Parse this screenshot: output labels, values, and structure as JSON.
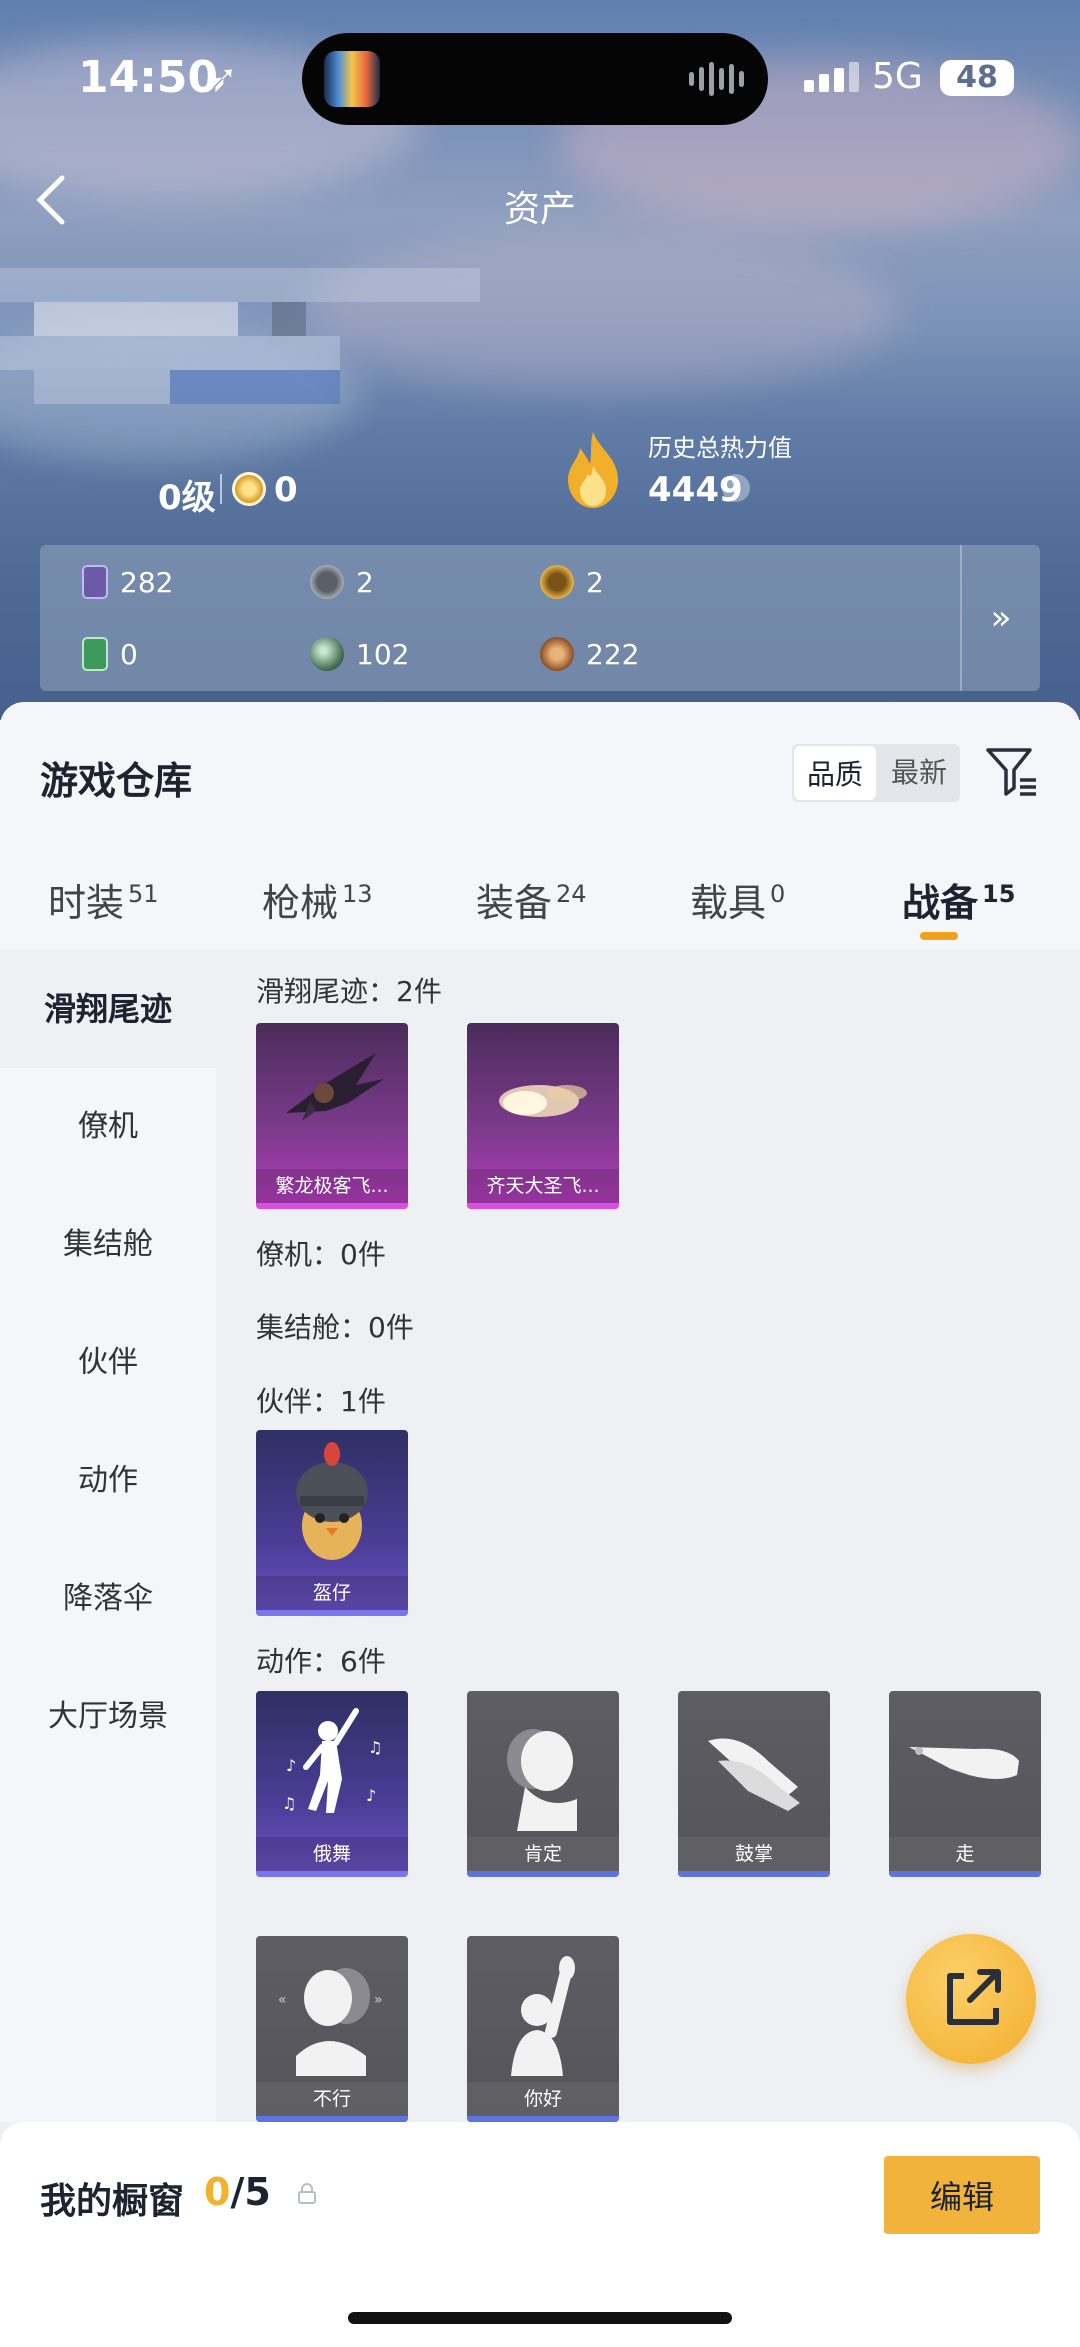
{
  "status_bar": {
    "time": "14:50",
    "network": "5G",
    "battery": "48"
  },
  "header": {
    "title": "资产"
  },
  "profile": {
    "level": "0级",
    "badge_value": "0",
    "heat_label": "历史总热力值",
    "heat_value": "4449",
    "help": "?"
  },
  "currencies": [
    {
      "icon": "purple-card-icon",
      "value": "282",
      "color": "#6b5aa8"
    },
    {
      "icon": "silver-coin-icon",
      "value": "2",
      "color": "#8a8f98"
    },
    {
      "icon": "gold-coin-icon",
      "value": "2",
      "color": "#d9a23a"
    },
    {
      "icon": "green-card-icon",
      "value": "0",
      "color": "#3e9a5c"
    },
    {
      "icon": "green-orb-icon",
      "value": "102",
      "color": "#5c8a6a"
    },
    {
      "icon": "bronze-coin-icon",
      "value": "222",
      "color": "#b8713a"
    }
  ],
  "currencies_more": "»",
  "warehouse": {
    "title": "游戏仓库",
    "sort_options": [
      "品质",
      "最新"
    ],
    "tabs": [
      {
        "label": "时装",
        "count": "51"
      },
      {
        "label": "枪械",
        "count": "13"
      },
      {
        "label": "装备",
        "count": "24"
      },
      {
        "label": "载具",
        "count": "0"
      },
      {
        "label": "战备",
        "count": "15"
      }
    ],
    "sidebar": [
      "滑翔尾迹",
      "僚机",
      "集结舱",
      "伙伴",
      "动作",
      "降落伞",
      "大厅场景"
    ],
    "sections": {
      "glide": {
        "title": "滑翔尾迹：2件",
        "items": [
          "繁龙极客飞...",
          "齐天大圣飞..."
        ]
      },
      "wingman": {
        "title": "僚机：0件"
      },
      "rally": {
        "title": "集结舱：0件"
      },
      "partner": {
        "title": "伙伴：1件",
        "items": [
          "盔仔"
        ]
      },
      "emote": {
        "title": "动作：6件",
        "items": [
          "俄舞",
          "肯定",
          "鼓掌",
          "走",
          "不行",
          "你好"
        ]
      }
    }
  },
  "showcase": {
    "title": "我的橱窗",
    "current": "0",
    "total": "/5",
    "edit_label": "编辑"
  }
}
